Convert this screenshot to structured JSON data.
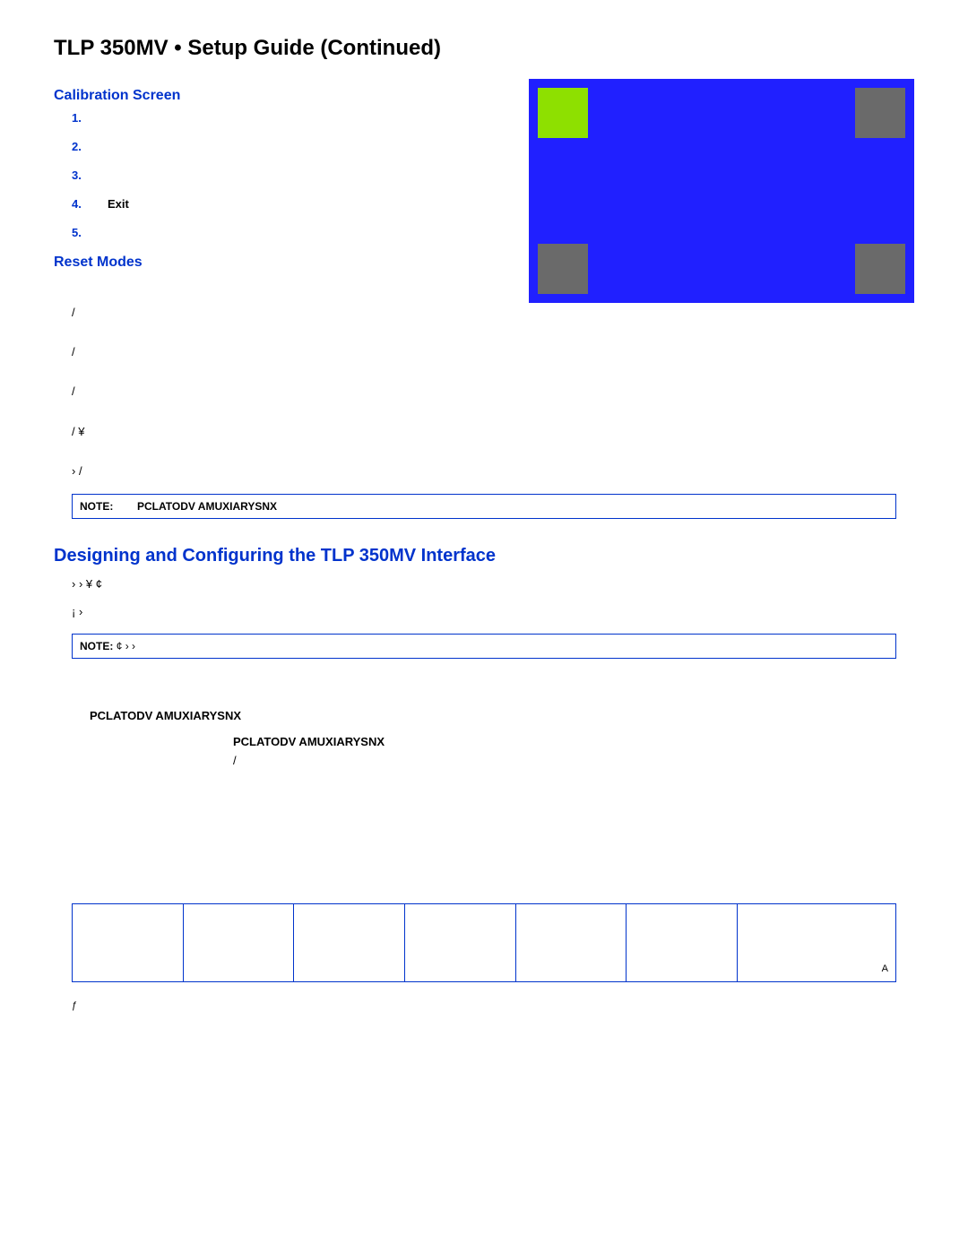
{
  "title": "TLP 350MV • Setup Guide (Continued)",
  "calibration": {
    "heading": "Calibration Screen",
    "steps": [
      {
        "num": "1.",
        "text": ""
      },
      {
        "num": "2.",
        "text": ""
      },
      {
        "num": "3.",
        "text": ""
      },
      {
        "num": "4.",
        "text": "Exit"
      },
      {
        "num": "5.",
        "text": ""
      }
    ]
  },
  "resetModes": {
    "heading": "Reset Modes",
    "lines": [
      "/",
      "/",
      "/",
      "/                                                                              ¥",
      "›                              /"
    ]
  },
  "note1": {
    "label": "NOTE:",
    "strong": "PCLATODV AMUXIARYSNX"
  },
  "design": {
    "heading": "Designing and Configuring the TLP 350MV Interface",
    "para1": "›                                        ›                                        ¥                        ¢",
    "para2": "¡                                                                              ›"
  },
  "note2": {
    "label": "NOTE:",
    "text": "¢                ›                                                                              ›"
  },
  "configItems": [
    {
      "bold": "PCLATODV AMUXIARYSNX",
      "rest": ""
    },
    {
      "bold": "PCLATODV AMUXIARYSNX",
      "rest": "/"
    }
  ],
  "table": {
    "cells": [
      "",
      "",
      "",
      "",
      "",
      "",
      "A"
    ]
  },
  "footnote": "ƒ"
}
